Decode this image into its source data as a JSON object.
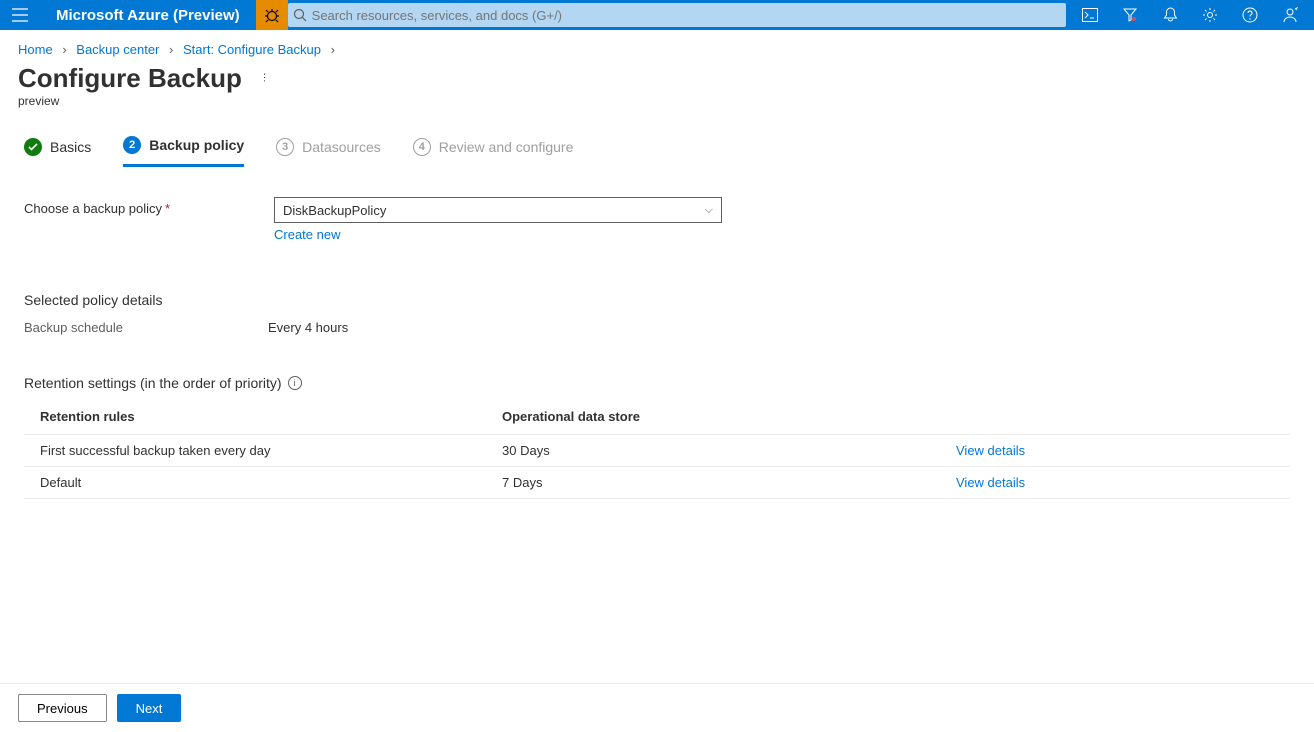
{
  "header": {
    "brand": "Microsoft Azure (Preview)",
    "search_placeholder": "Search resources, services, and docs (G+/)"
  },
  "breadcrumb": {
    "items": [
      "Home",
      "Backup center",
      "Start: Configure Backup"
    ]
  },
  "page": {
    "title": "Configure Backup",
    "subtitle": "preview"
  },
  "steps": [
    {
      "label": "Basics",
      "num": "✓"
    },
    {
      "label": "Backup policy",
      "num": "2"
    },
    {
      "label": "Datasources",
      "num": "3"
    },
    {
      "label": "Review and configure",
      "num": "4"
    }
  ],
  "policy": {
    "choose_label": "Choose a backup policy",
    "selected": "DiskBackupPolicy",
    "create_new": "Create new"
  },
  "selected_details": {
    "heading": "Selected policy details",
    "schedule_label": "Backup schedule",
    "schedule_value": "Every 4 hours"
  },
  "retention": {
    "heading": "Retention settings (in the order of priority)",
    "columns": {
      "c1": "Retention rules",
      "c2": "Operational data store"
    },
    "rows": [
      {
        "rule": "First successful backup taken every day",
        "store": "30 Days",
        "link": "View details"
      },
      {
        "rule": "Default",
        "store": "7 Days",
        "link": "View details"
      }
    ]
  },
  "footer": {
    "prev": "Previous",
    "next": "Next"
  }
}
